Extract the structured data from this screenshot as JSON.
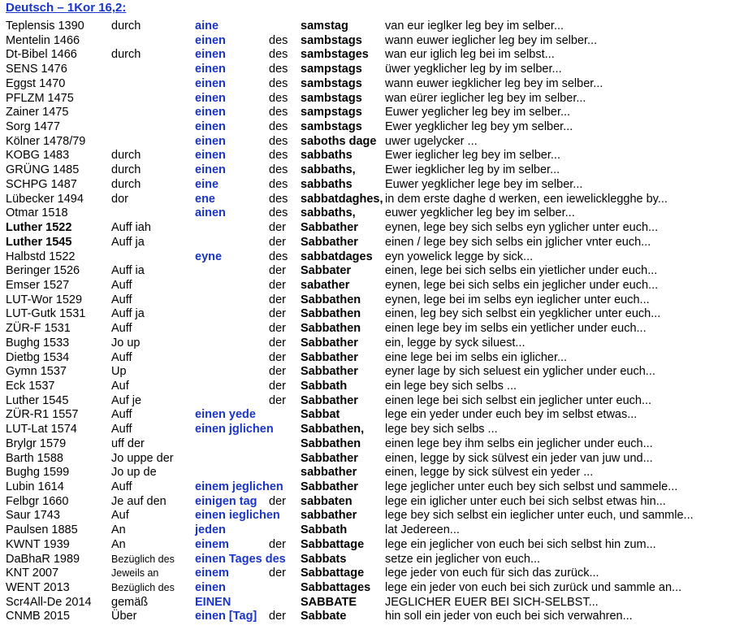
{
  "title": "Deutsch – 1Kor 16,2:",
  "rows": [
    {
      "src": "Teplensis 1390",
      "prep": "durch",
      "art": "aine",
      "gen": "",
      "noun": "samstag",
      "rest": "van eur   ieglker   leg bey   im   selber..."
    },
    {
      "src": "Mentelin 1466",
      "prep": "",
      "art": "einen",
      "gen": "des",
      "noun": "sambstags",
      "rest": "wann euwer   ieglicher   leg bey   im   selber..."
    },
    {
      "src": "Dt-Bibel 1466",
      "prep": "durch",
      "art": "einen",
      "gen": "des",
      "noun": "sambstages",
      "rest": "wan eur   iglich   leg bei   im   selbst..."
    },
    {
      "src": "SENS 1476",
      "prep": "",
      "art": "einen",
      "gen": "des",
      "noun": "sampstags",
      "rest": "üwer   yegklicher leg by   im   selber..."
    },
    {
      "src": "Eggst 1470",
      "prep": "",
      "art": "einen",
      "gen": "des",
      "noun": "sambstags",
      "rest": "wann euwer   iegklicher leg bey   im   selber..."
    },
    {
      "src": "PFLZM 1475",
      "prep": "",
      "art": "einen",
      "gen": "des",
      "noun": "sambstags",
      "rest": "wan eürer   ieglicher   leg bey   im   selber..."
    },
    {
      "src": "Zainer 1475",
      "prep": "",
      "art": "einen",
      "gen": "des",
      "noun": "sampstags",
      "rest": "Euwer   yeglicher   leg bey   im   selber..."
    },
    {
      "src": "Sorg 1477",
      "prep": "",
      "art": "einen",
      "gen": "des",
      "noun": "sambstags",
      "rest": "Ewer   yegklicher leg bey   ym   selber..."
    },
    {
      "src": "Kölner 1478/79",
      "prep": "",
      "art": "einen",
      "gen": "des",
      "noun": "saboths dage",
      "rest": "uwer   ugelycker ..."
    },
    {
      "src": "KOBG 1483",
      "prep": "durch",
      "art": "einen",
      "gen": "des",
      "noun": "sabbaths",
      "rest": "Ewer   ieglicher   leg bey   im   selber..."
    },
    {
      "src": "GRÜNG 1485",
      "prep": "durch",
      "art": "einen",
      "gen": "des",
      "noun": "sabbaths,",
      "rest": "Ewer   iegklicher leg by   im   selber..."
    },
    {
      "src": "SCHPG 1487",
      "prep": "durch",
      "art": "eine",
      "gen": "des",
      "noun": "sabbaths",
      "rest": "Euwer   yegklicher lege bey   im   selber..."
    },
    {
      "src": "Lübecker 1494",
      "prep": "dor",
      "art": "ene",
      "gen": "des",
      "noun": "sabbatdaghes,",
      "rest": "in dem erste daghe d werken, een iewelicklegghe by..."
    },
    {
      "src": "Otmar 1518",
      "prep": "",
      "art": "ainen",
      "gen": "des",
      "noun": "sabbaths,",
      "rest": "euwer   yegklicher leg bey   im   selber..."
    },
    {
      "src": "Luther 1522",
      "prep": "Auff iah",
      "art": "",
      "gen": "der",
      "noun": "Sabbather",
      "rest": "eynen, lege bey sich selbs eyn yglicher unter   euch..."
    },
    {
      "src": "Luther 1545",
      "prep": "Auff ja",
      "art": "",
      "gen": "der",
      "noun": "Sabbather",
      "rest": "einen / lege bey sich selbs ein jglicher vnter   euch..."
    },
    {
      "src": "Halbstd 1522",
      "prep": "",
      "art": "eyne",
      "gen": "des",
      "noun": "sabbatdages",
      "rest": "eyn   yowelick legge by sick..."
    },
    {
      "src": "Beringer 1526",
      "prep": "Auff ia",
      "art": "",
      "gen": "der",
      "noun": "Sabbater",
      "rest": "einen, lege bei sich selbs ein yietlicher under   euch..."
    },
    {
      "src": "Emser 1527",
      "prep": "Auff",
      "art": "",
      "gen": "der",
      "noun": "sabather",
      "rest": "eynen, lege bei sich selbs ein jeglicher under   euch..."
    },
    {
      "src": "LUT-Wor 1529",
      "prep": "Auff",
      "art": "",
      "gen": "der",
      "noun": "Sabbathen",
      "rest": "eynen, lege bei im   selbs eyn ieglicher unter   euch..."
    },
    {
      "src": "LUT-Gutk 1531",
      "prep": "Auff ja",
      "art": "",
      "gen": "der",
      "noun": "Sabbathen",
      "rest": "einen, leg   bey sich selbst ein yegklicher unter   euch..."
    },
    {
      "src": "ZÜR-F 1531",
      "prep": "Auff",
      "art": "",
      "gen": "der",
      "noun": "Sabbathen",
      "rest": "einen   lege bey im   selbs ein yetlicher under   euch..."
    },
    {
      "src": "Bughg 1533",
      "prep": "Jo up",
      "art": "",
      "gen": "der",
      "noun": "Sabbather",
      "rest": "ein,   legge by syck   siluest..."
    },
    {
      "src": "Dietbg 1534",
      "prep": "Auff",
      "art": "",
      "gen": "der",
      "noun": "Sabbather",
      "rest": "eine   lege bei im   selbs ein   iglicher..."
    },
    {
      "src": "Gymn 1537",
      "prep": "Up",
      "art": "",
      "gen": "der",
      "noun": "Sabbather",
      "rest": "eyner   lage by sich   seluest ein   yglicher under   euch..."
    },
    {
      "src": "Eck 1537",
      "prep": "Auf",
      "art": "",
      "gen": "der",
      "noun": "Sabbath",
      "rest": "ein   lege bey sich selbs ..."
    },
    {
      "src": "Luther 1545",
      "prep": "Auf je",
      "art": "",
      "gen": "der",
      "noun": "Sabbather",
      "rest": "einen   lege bei sich selbst ein jeglicher unter   euch..."
    },
    {
      "src": "ZÜR-R1 1557",
      "prep": "Auff",
      "art": "einen yede",
      "gen": "",
      "noun": "Sabbat",
      "rest": "lege ein yeder under euch bey im selbst etwas..."
    },
    {
      "src": "LUT-Lat 1574",
      "prep": "Auff",
      "art": "einen jglichen",
      "gen": "",
      "noun": "Sabbathen,",
      "rest": "lege bey sich selbs ..."
    },
    {
      "src": "Brylgr 1579",
      "prep": "uff der",
      "art": "",
      "gen": "",
      "noun": "Sabbathen",
      "rest": "einen   lege bey ihm selbs ein   jeglicher under   euch..."
    },
    {
      "src": "Barth 1588",
      "prep": "Jo uppe der",
      "art": "",
      "gen": "",
      "noun": "Sabbather",
      "rest": "einen,   legge by sick   sülvest ein   jeder   van juw und..."
    },
    {
      "src": "Bughg 1599",
      "prep": "Jo up de",
      "art": "",
      "gen": "",
      "noun": "sabbather",
      "rest": "einen,   legge by sick   sülvest ein   yeder   ..."
    },
    {
      "src": "Lubin 1614",
      "prep": "Auff",
      "art": "einem jeglichen",
      "gen": "",
      "noun": "Sabbather",
      "rest": "lege jeglicher unter euch bey sich selbst und sammele..."
    },
    {
      "src": "Felbgr 1660",
      "prep": "Je auf den",
      "art": "einigen tag",
      "gen": "der",
      "noun": "sabbaten",
      "rest": "lege ein iglicher unter euch bei sich selbst etwas hin..."
    },
    {
      "src": "Saur 1743",
      "prep": "Auf",
      "art": "einen ieglichen",
      "gen": "",
      "noun": "sabbather",
      "rest": "lege bey sich selbst ein ieglicher unter euch, und sammle..."
    },
    {
      "src": "Paulsen 1885",
      "prep": "An",
      "art": "jeden",
      "gen": "",
      "noun": "Sabbath",
      "rest": "lat Jedereen..."
    },
    {
      "src": "KWNT 1939",
      "prep": "An",
      "art": "einem",
      "gen": "der",
      "noun": "Sabbattage",
      "rest": "lege ein jeglicher von euch bei sich selbst hin zum..."
    },
    {
      "src": "DaBhaR 1989",
      "prep": "Bezüglich des",
      "art": "einen Tages des",
      "gen": "",
      "noun": "Sabbats",
      "rest": "setze ein jeglicher von euch..."
    },
    {
      "src": "KNT 2007",
      "prep": "Jeweils an",
      "art": "einem",
      "gen": "der",
      "noun": "Sabbattage",
      "rest": "lege jeder von euch für sich das zurück..."
    },
    {
      "src": "WENT 2013",
      "prep": "Bezüglich des",
      "art": "einen",
      "gen": "",
      "noun": "Sabbattages",
      "rest": "lege ein jeder von euch bei sich zurück und sammle an..."
    },
    {
      "src": "Scr4All-De 2014",
      "prep": "gemäß",
      "art": "EINEN",
      "gen": "",
      "noun": "SABBATE",
      "rest": "JEGLICHER EUER BEI SICH-SELBST..."
    },
    {
      "src": "CNMB 2015",
      "prep": "Über",
      "art": "einen [Tag]",
      "gen": "der",
      "noun": "Sabbate",
      "rest": "hin soll ein jeder von euch bei sich verwahren..."
    }
  ]
}
